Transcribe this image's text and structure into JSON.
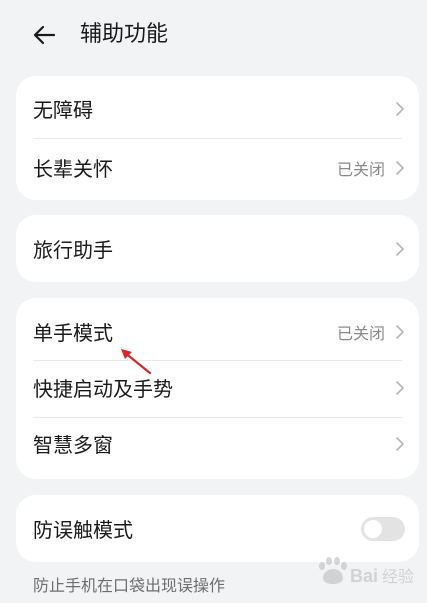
{
  "header": {
    "title": "辅助功能",
    "back_icon": "arrow-left-icon"
  },
  "group1": {
    "items": [
      {
        "label": "无障碍",
        "value": ""
      },
      {
        "label": "长辈关怀",
        "value": "已关闭"
      }
    ]
  },
  "group2": {
    "items": [
      {
        "label": "旅行助手",
        "value": ""
      }
    ]
  },
  "group3": {
    "items": [
      {
        "label": "单手模式",
        "value": "已关闭"
      },
      {
        "label": "快捷启动及手势",
        "value": ""
      },
      {
        "label": "智慧多窗",
        "value": ""
      }
    ]
  },
  "group4": {
    "items": [
      {
        "label": "防误触模式",
        "toggle": false
      }
    ]
  },
  "footnote": "防止手机在口袋出现误操作",
  "watermark": {
    "text": "Baidu经验"
  },
  "colors": {
    "background": "#f1f3f5",
    "card": "#ffffff",
    "annotation_arrow": "#d62828"
  }
}
